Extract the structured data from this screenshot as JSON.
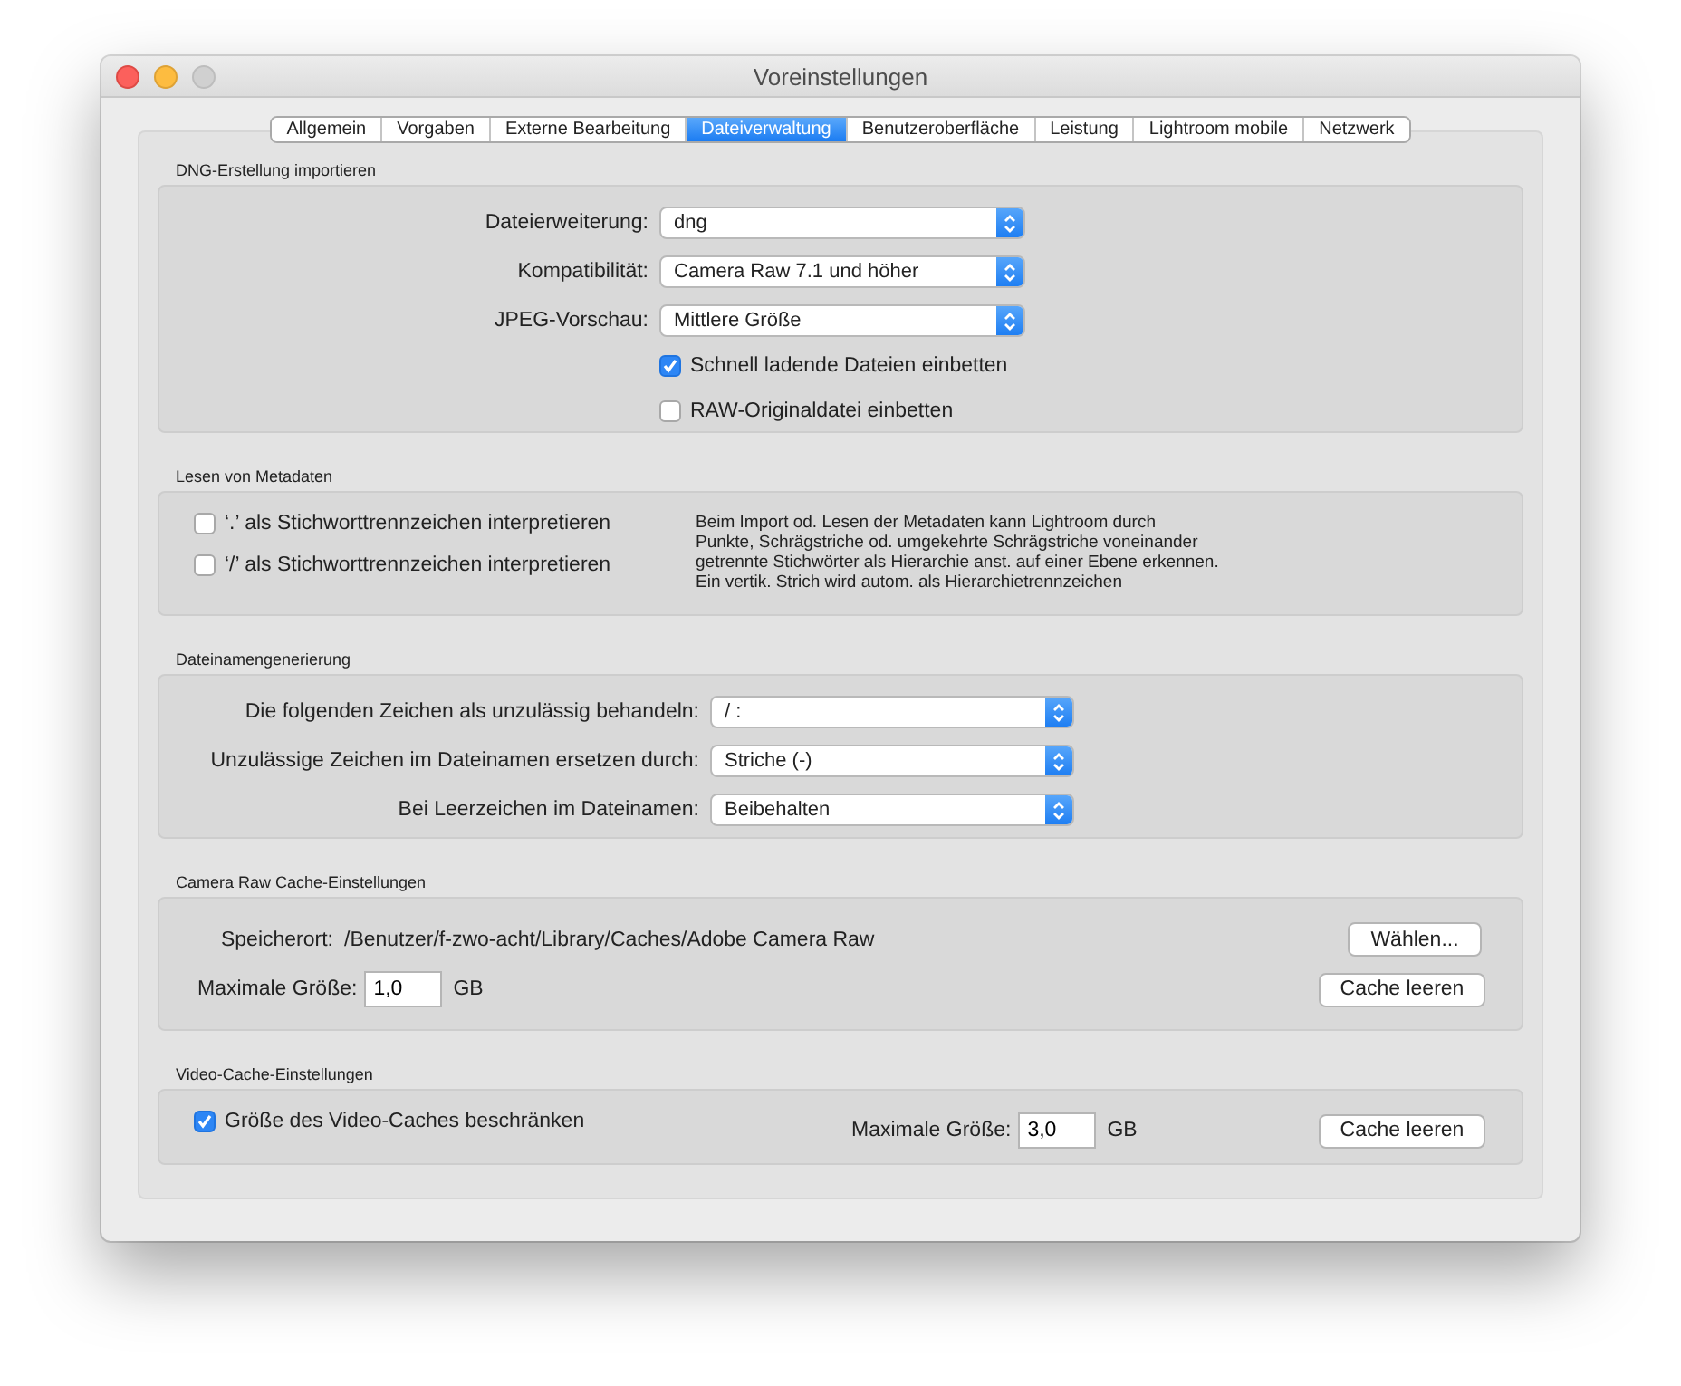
{
  "window": {
    "title": "Voreinstellungen"
  },
  "tabs": [
    {
      "label": "Allgemein",
      "selected": false
    },
    {
      "label": "Vorgaben",
      "selected": false
    },
    {
      "label": "Externe Bearbeitung",
      "selected": false
    },
    {
      "label": "Dateiverwaltung",
      "selected": true
    },
    {
      "label": "Benutzeroberfläche",
      "selected": false
    },
    {
      "label": "Leistung",
      "selected": false
    },
    {
      "label": "Lightroom mobile",
      "selected": false
    },
    {
      "label": "Netzwerk",
      "selected": false
    }
  ],
  "dng_section": {
    "title": "DNG-Erstellung importieren",
    "fields": [
      {
        "label": "Dateierweiterung:",
        "value": "dng"
      },
      {
        "label": "Kompatibilität:",
        "value": "Camera Raw 7.1 und höher"
      },
      {
        "label": "JPEG-Vorschau:",
        "value": "Mittlere Größe"
      }
    ],
    "checkboxes": [
      {
        "label": "Schnell ladende Dateien einbetten",
        "checked": true
      },
      {
        "label": "RAW-Originaldatei einbetten",
        "checked": false
      }
    ]
  },
  "metadata_section": {
    "title": "Lesen von Metadaten",
    "checkboxes": [
      {
        "label": "‘.’ als Stichworttrennzeichen interpretieren",
        "checked": false
      },
      {
        "label": "‘/’ als Stichworttrennzeichen interpretieren",
        "checked": false
      }
    ],
    "description": [
      "Beim Import od. Lesen der Metadaten kann Lightroom durch",
      "Punkte, Schrägstriche od. umgekehrte Schrägstriche voneinander",
      "getrennte Stichwörter als Hierarchie anst. auf einer Ebene erkennen.",
      "Ein vertik. Strich wird autom. als Hierarchietrennzeichen"
    ]
  },
  "filename_section": {
    "title": "Dateinamengenerierung",
    "fields": [
      {
        "label": "Die folgenden Zeichen als unzulässig behandeln:",
        "value": "/ :"
      },
      {
        "label": "Unzulässige Zeichen im Dateinamen ersetzen durch:",
        "value": "Striche (-)"
      },
      {
        "label": "Bei Leerzeichen im Dateinamen:",
        "value": "Beibehalten"
      }
    ]
  },
  "camera_raw_cache": {
    "title": "Camera Raw Cache-Einstellungen",
    "location_label": "Speicherort:",
    "location_path": "/Benutzer/f-zwo-acht/Library/Caches/Adobe Camera Raw",
    "choose_button": "Wählen...",
    "size_label": "Maximale Größe:",
    "size_value": "1,0",
    "unit": "GB",
    "clear_button": "Cache leeren"
  },
  "video_cache": {
    "title": "Video-Cache-Einstellungen",
    "limit_checkbox": {
      "label": "Größe des Video-Caches beschränken",
      "checked": true
    },
    "size_label": "Maximale Größe:",
    "size_value": "3,0",
    "unit": "GB",
    "clear_button": "Cache leeren"
  }
}
